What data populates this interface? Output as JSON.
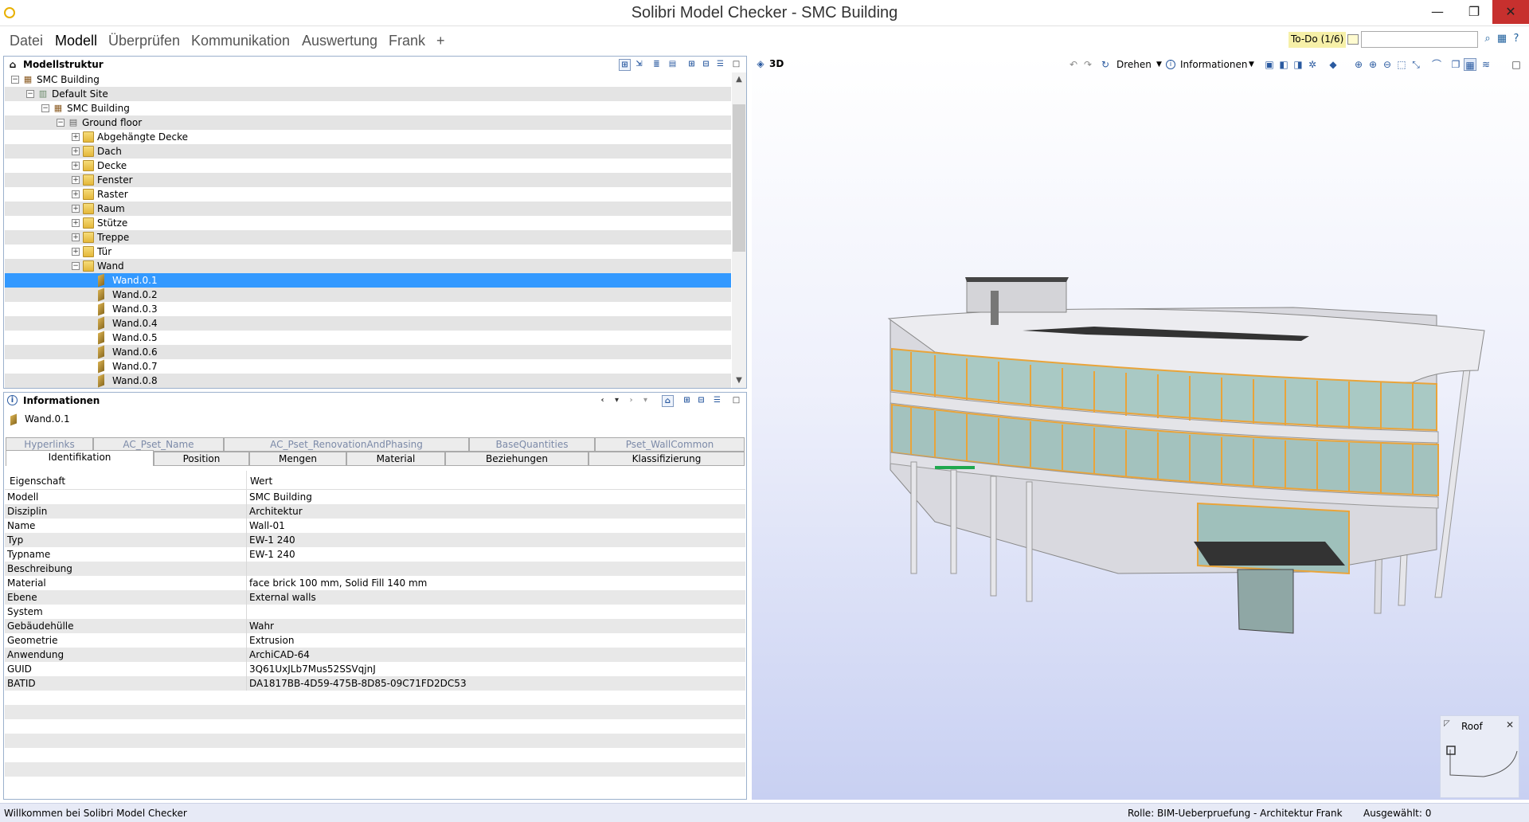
{
  "window": {
    "title": "Solibri Model Checker - SMC Building"
  },
  "menu": [
    "Datei",
    "Modell",
    "Überprüfen",
    "Kommunikation",
    "Auswertung",
    "Frank",
    "+"
  ],
  "todo": {
    "label": "To-Do (1/6)",
    "search_value": ""
  },
  "tree_panel": {
    "title": "Modellstruktur"
  },
  "tree": [
    {
      "label": "SMC Building",
      "exp": "−",
      "icon": "building-icon"
    },
    {
      "label": "Default Site",
      "exp": "−",
      "icon": "site-icon"
    },
    {
      "label": "SMC Building",
      "exp": "−",
      "icon": "building-icon"
    },
    {
      "label": "Ground floor",
      "exp": "−",
      "icon": "floor-icon"
    },
    {
      "label": "Abgehängte Decke",
      "exp": "+",
      "icon": "folder-icon"
    },
    {
      "label": "Dach",
      "exp": "+",
      "icon": "folder-icon"
    },
    {
      "label": "Decke",
      "exp": "+",
      "icon": "folder-icon"
    },
    {
      "label": "Fenster",
      "exp": "+",
      "icon": "folder-icon"
    },
    {
      "label": "Raster",
      "exp": "+",
      "icon": "folder-icon"
    },
    {
      "label": "Raum",
      "exp": "+",
      "icon": "folder-icon"
    },
    {
      "label": "Stütze",
      "exp": "+",
      "icon": "folder-icon"
    },
    {
      "label": "Treppe",
      "exp": "+",
      "icon": "folder-icon"
    },
    {
      "label": "Tür",
      "exp": "+",
      "icon": "folder-icon"
    },
    {
      "label": "Wand",
      "exp": "−",
      "icon": "folder-icon"
    },
    {
      "label": "Wand.0.1",
      "exp": "",
      "icon": "wall-icon",
      "selected": true
    },
    {
      "label": "Wand.0.2",
      "exp": "",
      "icon": "wall-icon"
    },
    {
      "label": "Wand.0.3",
      "exp": "",
      "icon": "wall-icon"
    },
    {
      "label": "Wand.0.4",
      "exp": "",
      "icon": "wall-icon"
    },
    {
      "label": "Wand.0.5",
      "exp": "",
      "icon": "wall-icon"
    },
    {
      "label": "Wand.0.6",
      "exp": "",
      "icon": "wall-icon"
    },
    {
      "label": "Wand.0.7",
      "exp": "",
      "icon": "wall-icon"
    },
    {
      "label": "Wand.0.8",
      "exp": "",
      "icon": "wall-icon"
    }
  ],
  "info_panel": {
    "title": "Informationen",
    "selected": "Wand.0.1"
  },
  "tabs_back": [
    "Hyperlinks",
    "AC_Pset_Name",
    "AC_Pset_RenovationAndPhasing",
    "BaseQuantities",
    "Pset_WallCommon"
  ],
  "tabs_front": [
    "Identifikation",
    "Position",
    "Mengen",
    "Material",
    "Beziehungen",
    "Klassifizierung"
  ],
  "properties": {
    "header": {
      "key": "Eigenschaft",
      "value": "Wert"
    },
    "rows": [
      {
        "key": "Modell",
        "value": "SMC Building"
      },
      {
        "key": "Disziplin",
        "value": "Architektur"
      },
      {
        "key": "Name",
        "value": "Wall-01"
      },
      {
        "key": "Typ",
        "value": "EW-1 240"
      },
      {
        "key": "Typname",
        "value": "EW-1 240"
      },
      {
        "key": "Beschreibung",
        "value": ""
      },
      {
        "key": "Material",
        "value": "face brick 100 mm, Solid Fill 140 mm"
      },
      {
        "key": "Ebene",
        "value": "External walls"
      },
      {
        "key": "System",
        "value": ""
      },
      {
        "key": "Gebäudehülle",
        "value": "Wahr"
      },
      {
        "key": "Geometrie",
        "value": "Extrusion"
      },
      {
        "key": "Anwendung",
        "value": "ArchiCAD-64"
      },
      {
        "key": "GUID",
        "value": "3Q61UxJLb7Mus52SSVqjnJ"
      },
      {
        "key": "BATID",
        "value": "DA1817BB-4D59-475B-8D85-09C71FD2DC53"
      }
    ]
  },
  "view3d": {
    "title": "3D",
    "rotate_label": "Drehen",
    "info_label": "Informationen"
  },
  "minimap": {
    "title": "Roof"
  },
  "status": {
    "welcome": "Willkommen bei Solibri Model Checker",
    "role": "Rolle: BIM-Ueberpruefung - Architektur Frank",
    "selected": "Ausgewählt: 0"
  },
  "colors": {
    "selection": "#3399ff",
    "close_button": "#c7302e",
    "frame_accent": "#f2a93b"
  }
}
